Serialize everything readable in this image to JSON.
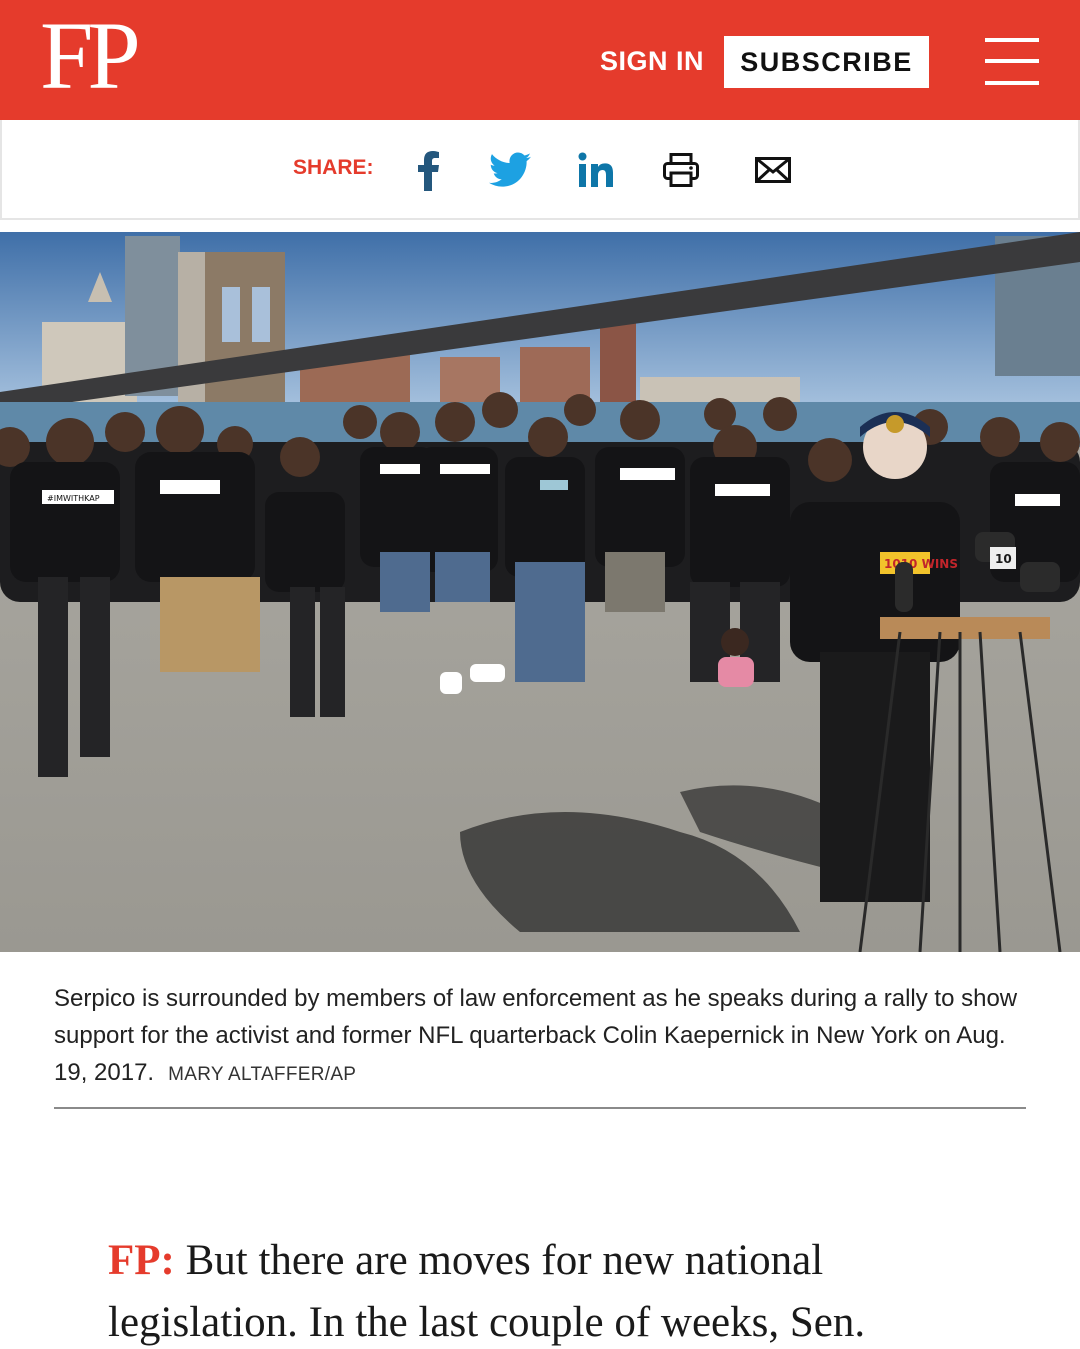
{
  "header": {
    "logo": "FP",
    "sign_in": "SIGN IN",
    "subscribe": "SUBSCRIBE",
    "brand_color": "#e53b2c"
  },
  "share": {
    "label": "SHARE:",
    "icons": [
      "facebook-icon",
      "twitter-icon",
      "linkedin-icon",
      "print-icon",
      "email-icon"
    ]
  },
  "hero": {
    "shirt_text": "#IMWITHKAP",
    "badge_text": "1010 WINS",
    "mic_text": "10"
  },
  "caption": {
    "text": "Serpico is surrounded by members of law enforcement as he speaks during a rally to show support for the activist and former NFL quarterback Colin Kaepernick in New York on Aug. 19, 2017.",
    "credit": "MARY ALTAFFER/AP"
  },
  "article": {
    "speaker": "FP:",
    "text": "But there are moves for new national legislation. In the last couple of weeks, Sen."
  }
}
